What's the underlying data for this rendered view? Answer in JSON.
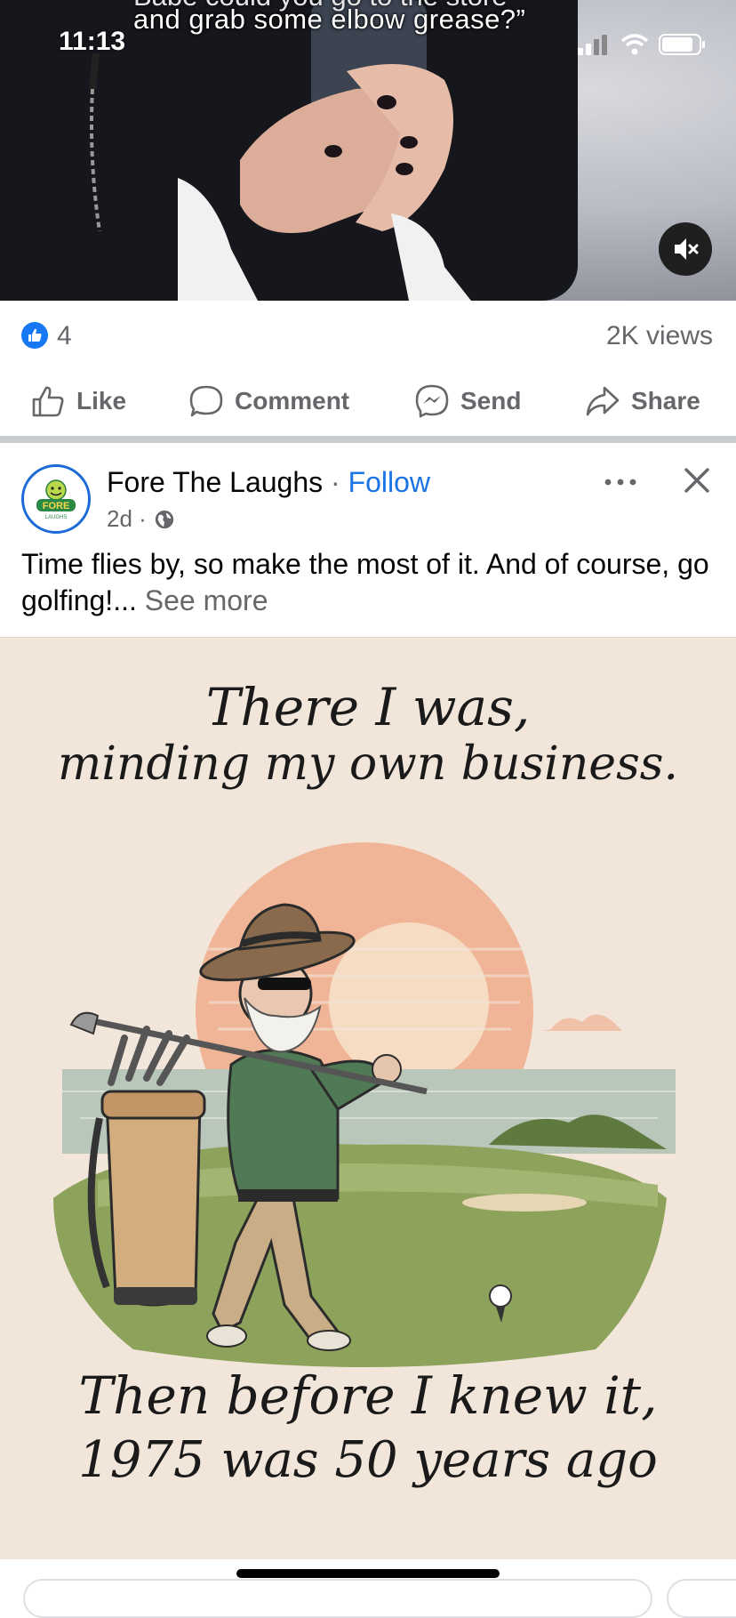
{
  "status_bar": {
    "time": "11:13"
  },
  "video": {
    "caption_top": "Babe could you go to the store",
    "caption": "and grab some elbow grease?”",
    "mute_icon": "speaker-muted-icon"
  },
  "stats": {
    "likes": "4",
    "views": "2K views"
  },
  "actions": [
    {
      "label": "Like",
      "icon": "thumbs-up-icon"
    },
    {
      "label": "Comment",
      "icon": "comment-bubble-icon"
    },
    {
      "label": "Send",
      "icon": "messenger-icon"
    },
    {
      "label": "Share",
      "icon": "share-arrow-icon"
    }
  ],
  "post": {
    "page_name": "Fore The Laughs",
    "separator": " · ",
    "follow_label": "Follow",
    "time": "2d ·",
    "avatar_text": "FORE",
    "avatar_subtext": "LAUGHS",
    "text": "Time flies by, so make the most of it. And of course, go golfing!...",
    "see_more": " See more",
    "image_text_top_line1": "There I was,",
    "image_text_top_line2": "minding my own business.",
    "image_text_bottom_line1": "Then before I knew it,",
    "image_text_bottom_line2": "1975 was 50 years ago"
  },
  "colors": {
    "accent": "#1b74e4",
    "like_blue": "#1877f2",
    "secondary_text": "#65676b",
    "image_bg": "#f2e6da"
  }
}
